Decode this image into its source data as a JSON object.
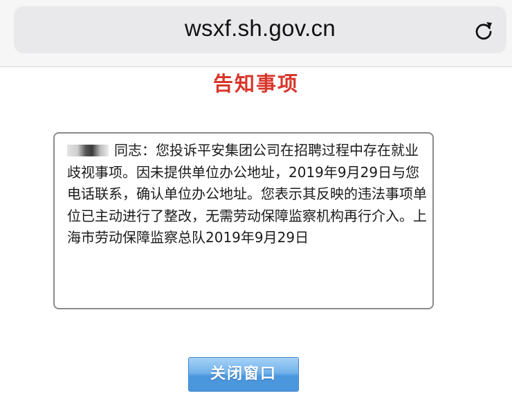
{
  "browser": {
    "url": "wsxf.sh.gov.cn",
    "reload_icon": "reload-icon"
  },
  "page": {
    "title": "告知事项",
    "notice": {
      "salutation": "同志：",
      "body": "您投诉平安集团公司在招聘过程中存在就业歧视事项。因未提供单位办公地址，2019年9月29日与您电话联系，确认单位办公地址。您表示其反映的违法事项单位已主动进行了整改，无需劳动保障监察机构再行介入。上海市劳动保障监察总队2019年9月29日"
    },
    "close_button": "关闭窗口"
  },
  "colors": {
    "title": "#d8352a",
    "button_top": "#a6d2f7",
    "button_bottom": "#4b97de",
    "box_border": "#8a8a8a"
  }
}
